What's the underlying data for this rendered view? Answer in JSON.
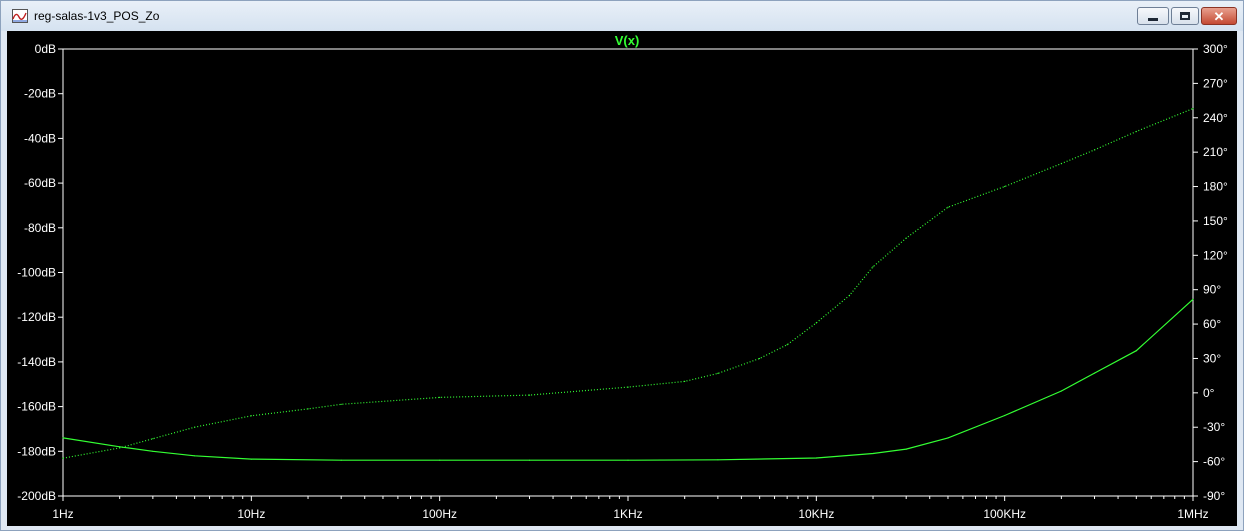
{
  "window": {
    "title": "reg-salas-1v3_POS_Zo",
    "icon": "ltspice-waveform-icon",
    "min_label": "",
    "max_label": "",
    "close_label": "✕"
  },
  "chart_data": {
    "type": "line",
    "title": "V(x)",
    "xscale": "log",
    "xlim": [
      1,
      1000000
    ],
    "xticks": [
      1,
      10,
      100,
      1000,
      10000,
      100000,
      1000000
    ],
    "xtick_labels": [
      "1Hz",
      "10Hz",
      "100Hz",
      "1KHz",
      "10KHz",
      "100KHz",
      "1MHz"
    ],
    "ylim": [
      -200,
      0
    ],
    "yticks": [
      0,
      -20,
      -40,
      -60,
      -80,
      -100,
      -120,
      -140,
      -160,
      -180,
      -200
    ],
    "ytick_labels": [
      "0dB",
      "-20dB",
      "-40dB",
      "-60dB",
      "-80dB",
      "-100dB",
      "-120dB",
      "-140dB",
      "-160dB",
      "-180dB",
      "-200dB"
    ],
    "y2lim": [
      -90,
      300
    ],
    "y2ticks": [
      300,
      270,
      240,
      210,
      180,
      150,
      120,
      90,
      60,
      30,
      0,
      -30,
      -60,
      -90
    ],
    "y2tick_labels": [
      "300°",
      "270°",
      "240°",
      "210°",
      "180°",
      "150°",
      "120°",
      "90°",
      "60°",
      "30°",
      "0°",
      "-30°",
      "-60°",
      "-90°"
    ],
    "grid": false,
    "background": "#000000",
    "trace_color": "#33ff33",
    "axis_color": "#ffffff",
    "series": [
      {
        "kind": "magnitude",
        "style": "solid",
        "unit": "dB",
        "x": [
          1,
          2,
          3,
          5,
          10,
          30,
          100,
          300,
          1000,
          3000,
          10000,
          20000,
          30000,
          50000,
          100000,
          200000,
          300000,
          500000,
          1000000
        ],
        "y": [
          -174,
          -178,
          -180,
          -182,
          -183.5,
          -184,
          -184,
          -184,
          -184,
          -183.8,
          -183,
          -181,
          -179,
          -174,
          -164,
          -153,
          -145,
          -135,
          -112
        ]
      },
      {
        "kind": "phase",
        "style": "dotted",
        "unit": "deg",
        "x": [
          1,
          2,
          3,
          5,
          10,
          20,
          30,
          100,
          300,
          1000,
          2000,
          3000,
          5000,
          7000,
          10000,
          15000,
          20000,
          30000,
          50000,
          100000,
          200000,
          300000,
          500000,
          1000000
        ],
        "y": [
          -57,
          -48,
          -40,
          -30,
          -20,
          -14,
          -10,
          -4,
          -2,
          5,
          10,
          17,
          30,
          42,
          61,
          85,
          110,
          135,
          162,
          180,
          200,
          212,
          228,
          248
        ]
      }
    ]
  }
}
